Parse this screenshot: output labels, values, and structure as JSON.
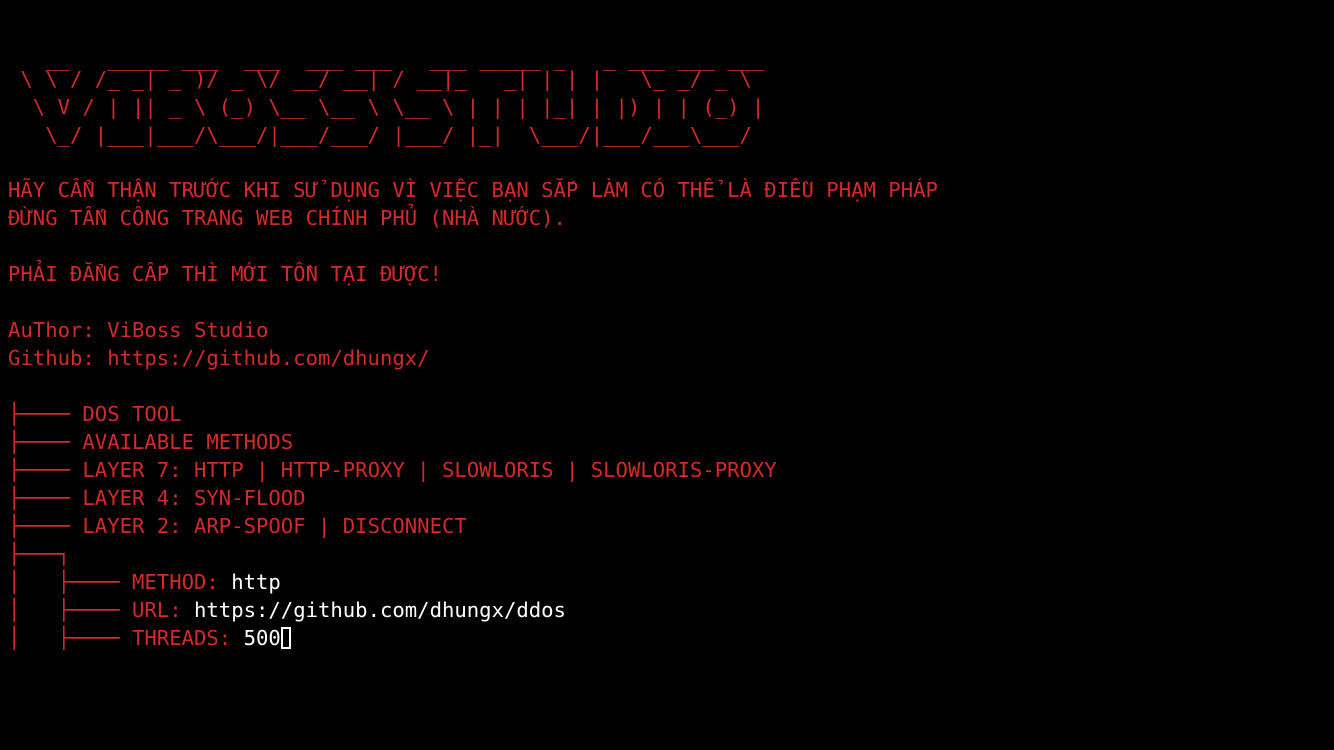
{
  "theme": {
    "background": "#000000",
    "text_color": "#d42a2a",
    "input_color": "#ffffff"
  },
  "banner": {
    "line1": "   __   _____ ___  ___  ___ ___   ___ _____ _   _ ___ ___ ___ ",
    "line2": " \\ \\ / /_ _| _ )/ _ \\/ __/ __| / __|_   _| | | |   \\_ _/ _ \\",
    "line3": "  \\ V / | || _ \\ (_) \\__ \\__ \\ \\__ \\ | | | |_| | |) | | (_) |",
    "line4": "   \\_/ |___|___/\\___/|___/___/ |___/ |_|  \\___/|___/___\\___/"
  },
  "warnings": {
    "line1": "HÃY CẨN THẬN TRƯỚC KHI SỬ DỤNG VÌ VIỆC BẠN SẮP LÀM CÓ THỂ LÀ ĐIỀU PHẠM PHÁP",
    "line2": "ĐỪNG TẤN CÔNG TRANG WEB CHÍNH PHỦ (NHÀ NƯỚC).",
    "motto": "PHẢI ĐẲNG CẤP THÌ MỚI TỒN TẠI ĐƯỢC!"
  },
  "info": {
    "author": "AuThor: ViBoss Studio",
    "github": "Github: https://github.com/dhungx/"
  },
  "tree": {
    "items": [
      {
        "prefix": "├──── ",
        "text": "DOS TOOL"
      },
      {
        "prefix": "├──── ",
        "text": "AVAILABLE METHODS"
      },
      {
        "prefix": "├──── ",
        "text": "LAYER 7: HTTP | HTTP-PROXY | SLOWLORIS | SLOWLORIS-PROXY"
      },
      {
        "prefix": "├──── ",
        "text": "LAYER 4: SYN-FLOOD"
      },
      {
        "prefix": "├──── ",
        "text": "LAYER 2: ARP-SPOOF | DISCONNECT"
      }
    ],
    "branch": "├───┐"
  },
  "prompts": [
    {
      "prefix": "│   ├──── ",
      "label": "METHOD: ",
      "value": "http"
    },
    {
      "prefix": "│   ├──── ",
      "label": "URL: ",
      "value": "https://github.com/dhungx/ddos"
    },
    {
      "prefix": "│   ├──── ",
      "label": "THREADS: ",
      "value": "500"
    }
  ]
}
